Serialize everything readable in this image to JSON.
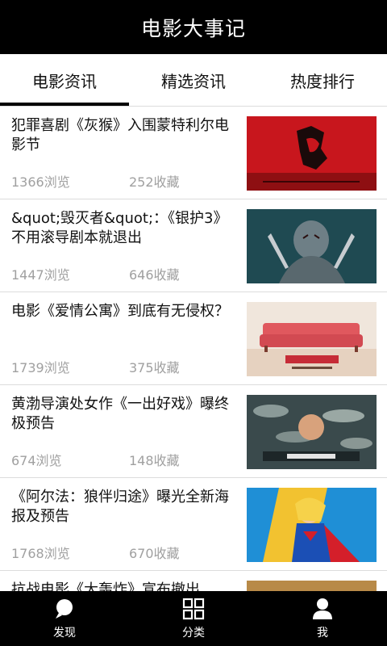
{
  "app": {
    "title": "电影大事记"
  },
  "tabs": [
    {
      "label": "电影资讯",
      "active": true
    },
    {
      "label": "精选资讯",
      "active": false
    },
    {
      "label": "热度排行",
      "active": false
    }
  ],
  "articles": [
    {
      "title": "犯罪喜剧《灰猴》入围蒙特利尔电影节",
      "views": "1366浏览",
      "favorites": "252收藏",
      "thumb_icon": "red-movie-poster-image"
    },
    {
      "title": "&quot;毁灭者&quot;：《银护3》不用滚导剧本就退出",
      "views": "1447浏览",
      "favorites": "646收藏",
      "thumb_icon": "teal-warrior-poster-image"
    },
    {
      "title": "电影《爱情公寓》到底有无侵权？",
      "views": "1739浏览",
      "favorites": "375收藏",
      "thumb_icon": "sofa-poster-image"
    },
    {
      "title": "黄渤导演处女作《一出好戏》曝终极预告",
      "views": "674浏览",
      "favorites": "148收藏",
      "thumb_icon": "fish-crowd-poster-image"
    },
    {
      "title": "《阿尔法：狼伴归途》曝光全新海报及预告",
      "views": "1768浏览",
      "favorites": "670收藏",
      "thumb_icon": "comic-hero-poster-image"
    },
    {
      "title": "抗战电影《大轰炸》宣布撤出",
      "views": "",
      "favorites": "",
      "thumb_icon": "dark-poster-image"
    }
  ],
  "bottom_nav": [
    {
      "label": "发现",
      "icon": "search-icon"
    },
    {
      "label": "分类",
      "icon": "grid-icon"
    },
    {
      "label": "我",
      "icon": "user-icon"
    }
  ],
  "colors": {
    "bar_bg": "#000000",
    "stats_text": "#a0a0a0",
    "divider": "#dcdcdc"
  }
}
